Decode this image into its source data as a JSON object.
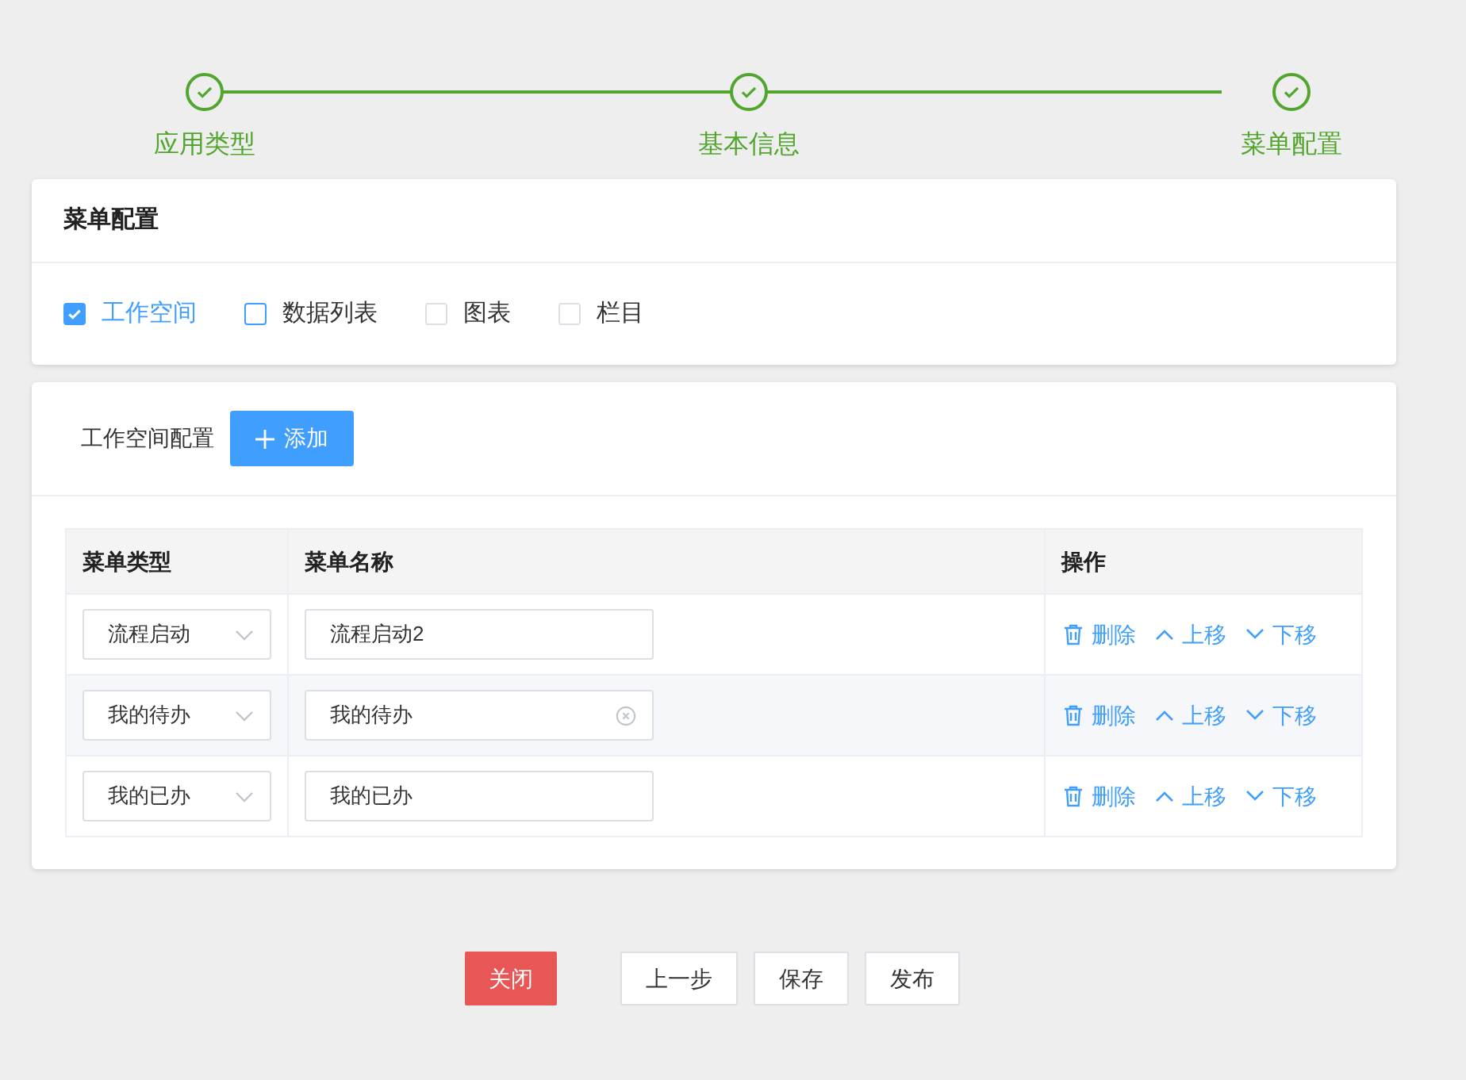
{
  "steps": [
    {
      "label": "应用类型",
      "done": true
    },
    {
      "label": "基本信息",
      "done": true
    },
    {
      "label": "菜单配置",
      "done": true
    }
  ],
  "menu_config": {
    "title": "菜单配置",
    "options": [
      {
        "label": "工作空间",
        "checked": true,
        "focused": false
      },
      {
        "label": "数据列表",
        "checked": false,
        "focused": true
      },
      {
        "label": "图表",
        "checked": false,
        "focused": false
      },
      {
        "label": "栏目",
        "checked": false,
        "focused": false
      }
    ]
  },
  "workspace_config": {
    "title": "工作空间配置",
    "add_button": "添加",
    "table": {
      "columns": [
        "菜单类型",
        "菜单名称",
        "操作"
      ],
      "rows": [
        {
          "type": "流程启动",
          "name": "流程启动2",
          "hovered": false,
          "actions": [
            "删除",
            "上移",
            "下移"
          ]
        },
        {
          "type": "我的待办",
          "name": "我的待办",
          "hovered": true,
          "actions": [
            "删除",
            "上移",
            "下移"
          ]
        },
        {
          "type": "我的已办",
          "name": "我的已办",
          "hovered": false,
          "actions": [
            "删除",
            "上移",
            "下移"
          ]
        }
      ]
    }
  },
  "footer": {
    "buttons": [
      {
        "label": "关闭",
        "kind": "danger"
      },
      {
        "label": "上一步",
        "kind": "default"
      },
      {
        "label": "保存",
        "kind": "default"
      },
      {
        "label": "发布",
        "kind": "default"
      }
    ]
  }
}
